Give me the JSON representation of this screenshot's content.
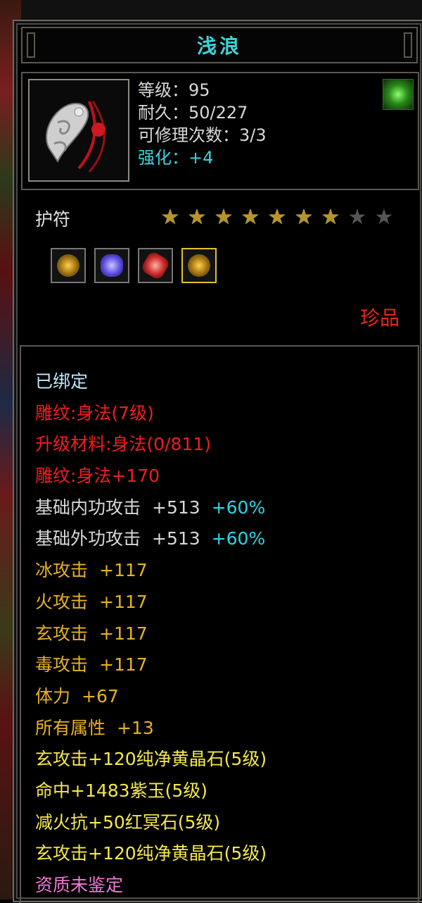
{
  "item": {
    "name": "浅浪",
    "level_label": "等级：95",
    "durability_label": "耐久：50/227",
    "repair_label": "可修理次数：3/3",
    "enhance_label": "强化：+4",
    "type": "护符",
    "rarity": "珍品",
    "rarity_color": "#e8261c",
    "stars_filled": 7,
    "stars_total": 9
  },
  "gems": [
    {
      "name": "yellow-gem-icon"
    },
    {
      "name": "purple-gem-icon"
    },
    {
      "name": "red-gem-icon"
    },
    {
      "name": "yellow-gem-icon",
      "selected": true
    }
  ],
  "attributes": [
    {
      "text": "已绑定",
      "color": "#bfe8ff"
    },
    {
      "text": "雕纹:身法(7级)",
      "color": "#f01e1e"
    },
    {
      "text": "升级材料:身法(0/811)",
      "color": "#f01e1e"
    },
    {
      "text": "雕纹:身法+170",
      "color": "#f01e1e"
    },
    {
      "text": "基础内功攻击",
      "value": "+513",
      "pct": "+60%",
      "color": "#d8d8d8"
    },
    {
      "text": "基础外功攻击",
      "value": "+513",
      "pct": "+60%",
      "color": "#d8d8d8"
    },
    {
      "text": "冰攻击",
      "value": "+117",
      "color": "#e7b21f"
    },
    {
      "text": "火攻击",
      "value": "+117",
      "color": "#e7b21f"
    },
    {
      "text": "玄攻击",
      "value": "+117",
      "color": "#e7b21f"
    },
    {
      "text": "毒攻击",
      "value": "+117",
      "color": "#e7b21f"
    },
    {
      "text": "体力",
      "value": "+67",
      "color": "#e7b21f"
    },
    {
      "text": "所有属性",
      "value": "+13",
      "color": "#e7b21f"
    },
    {
      "text": "玄攻击+120纯净黄晶石(5级)",
      "color": "#f4e94a"
    },
    {
      "text": "命中+1483紫玉(5级)",
      "color": "#f4e94a"
    },
    {
      "text": "减火抗+50红冥石(5级)",
      "color": "#f4e94a"
    },
    {
      "text": "玄攻击+120纯净黄晶石(5级)",
      "color": "#f4e94a"
    },
    {
      "text": "资质未鉴定",
      "color": "#f07ad8"
    }
  ]
}
